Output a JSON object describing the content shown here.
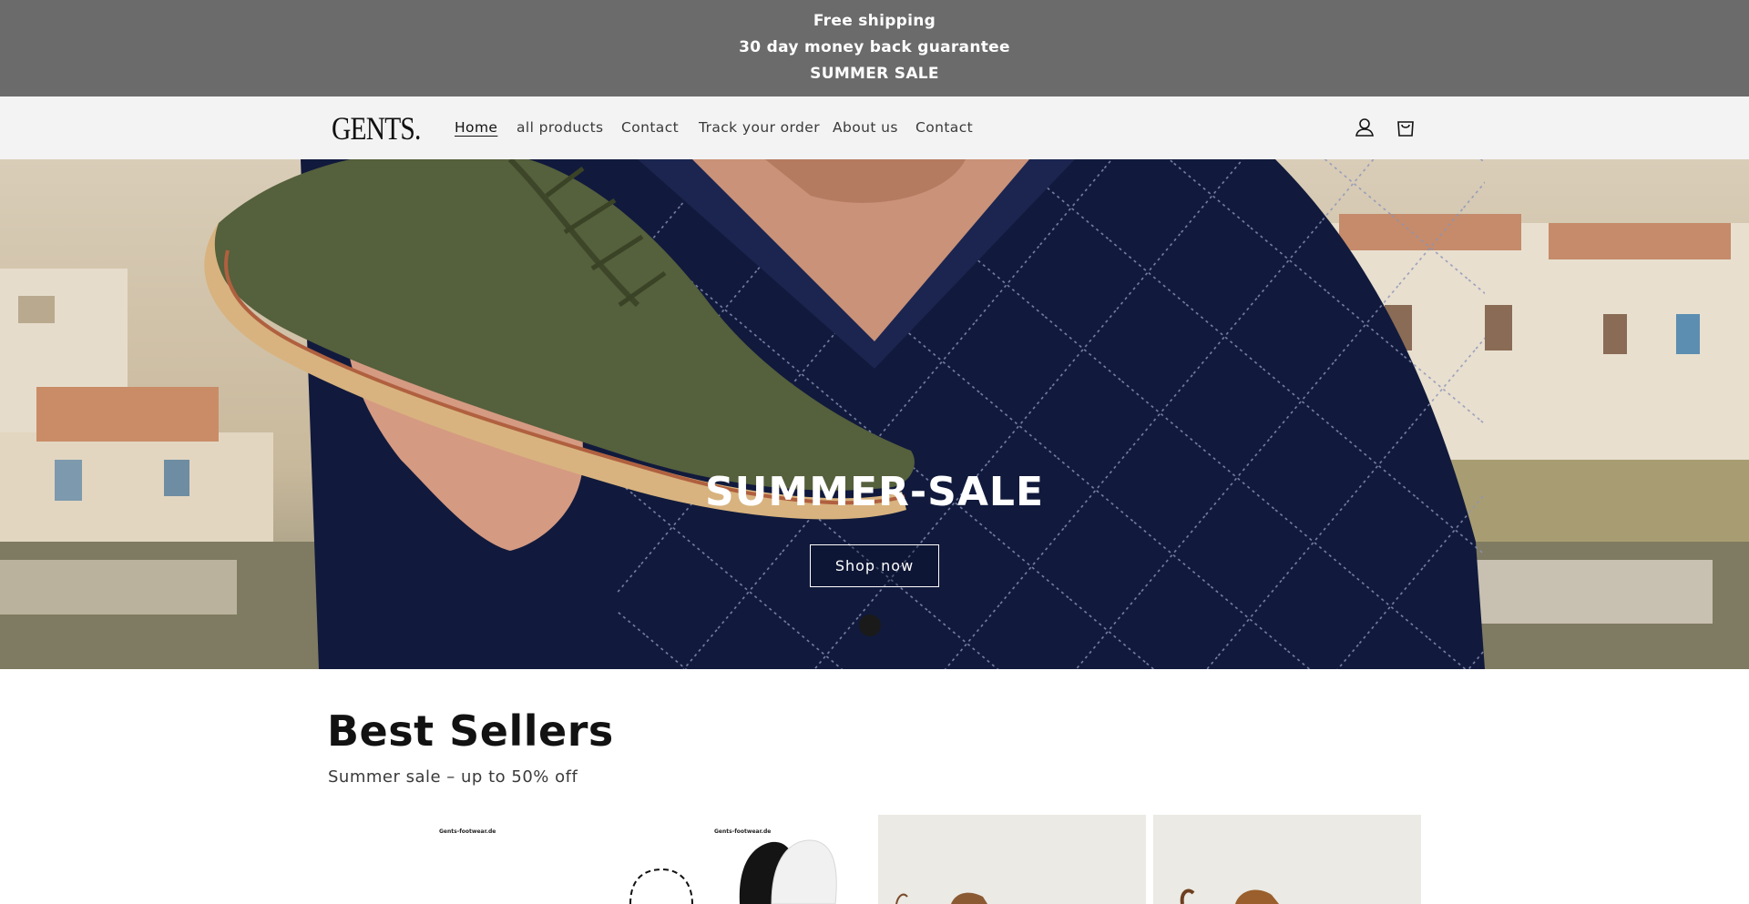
{
  "announcement": {
    "line1": "Free shipping",
    "line2": "30 day money back guarantee",
    "line3": "SUMMER SALE"
  },
  "header": {
    "logo": "GENTS.",
    "nav": [
      {
        "label": "Home",
        "active": true
      },
      {
        "label": "all products"
      },
      {
        "label": "Contact"
      },
      {
        "label": "Track your order"
      },
      {
        "label": "About us"
      },
      {
        "label": "Contact"
      }
    ],
    "icons": [
      "account-icon",
      "cart-icon"
    ]
  },
  "hero": {
    "title": "SUMMER-SALE",
    "button_label": "Shop now"
  },
  "best_sellers": {
    "title": "Best Sellers",
    "subtitle": "Summer sale – up to 50% off",
    "products": [
      {
        "brand_text": "Gents-footwear.de"
      },
      {
        "brand_text": "Gents-footwear.de"
      },
      {},
      {}
    ]
  },
  "colors": {
    "announcement_bg": "#6b6b6b",
    "header_bg": "#f3f3f3",
    "text": "#121212"
  }
}
